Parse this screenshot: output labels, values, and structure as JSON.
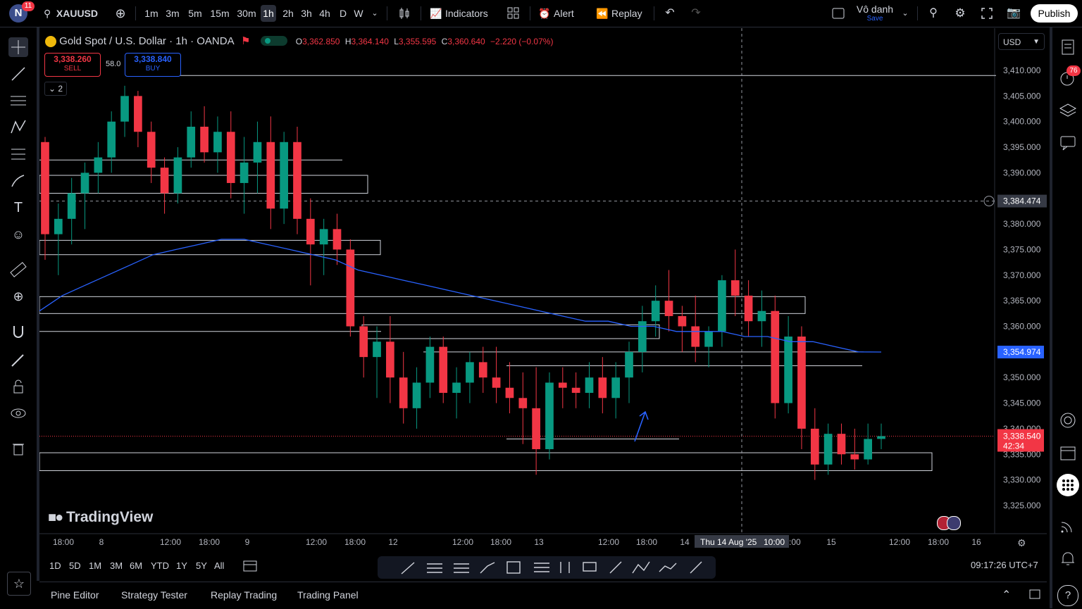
{
  "header": {
    "user_initial": "N",
    "notif_count": "11",
    "symbol": "XAUUSD",
    "timeframes": [
      "1m",
      "3m",
      "5m",
      "15m",
      "30m",
      "1h",
      "2h",
      "3h",
      "4h",
      "D",
      "W"
    ],
    "active_timeframe": "1h",
    "indicators_label": "Indicators",
    "alert_label": "Alert",
    "replay_label": "Replay",
    "layout_name": "Vô danh",
    "layout_save": "Save",
    "publish_label": "Publish"
  },
  "legend": {
    "title": "Gold Spot / U.S. Dollar · 1h · OANDA",
    "o_label": "O",
    "o": "3,362.850",
    "h_label": "H",
    "h": "3,364.140",
    "l_label": "L",
    "l": "3,355.595",
    "c_label": "C",
    "c": "3,360.640",
    "change": "−2.220 (−0.07%)",
    "sell_price": "3,338.260",
    "sell_label": "SELL",
    "spread": "58.0",
    "buy_price": "3,338.840",
    "buy_label": "BUY",
    "collapse_count": "2"
  },
  "price_axis": {
    "currency": "USD",
    "ticks": [
      "3,410.000",
      "3,405.000",
      "3,400.000",
      "3,395.000",
      "3,390.000",
      "3,385.000",
      "3,380.000",
      "3,375.000",
      "3,370.000",
      "3,365.000",
      "3,360.000",
      "3,355.000",
      "3,350.000",
      "3,345.000",
      "3,340.000",
      "3,335.000",
      "3,330.000",
      "3,325.000"
    ],
    "crosshair_price": "3,384.474",
    "ma_price": "3,354.974",
    "last_price": "3,338.540",
    "countdown": "42:34"
  },
  "time_axis": {
    "labels": [
      "18:00",
      "8",
      "12:00",
      "18:00",
      "9",
      "12:00",
      "18:00",
      "12",
      "12:00",
      "18:00",
      "13",
      "12:00",
      "18:00",
      "14",
      "15",
      "12:00",
      "18:00",
      "16"
    ],
    "crosshair_time": "Thu 14 Aug '25",
    "crosshair_time_2": "10:00",
    "partial_label": ":00"
  },
  "watermark": "TradingView",
  "right_panel": {
    "badge": "76"
  },
  "bottom": {
    "ranges": [
      "1D",
      "5D",
      "1M",
      "3M",
      "6M",
      "YTD",
      "1Y",
      "5Y",
      "All"
    ],
    "clock": "09:17:26 UTC+7",
    "tabs": [
      "Pine Editor",
      "Strategy Tester",
      "Replay Trading",
      "Trading Panel"
    ]
  },
  "colors": {
    "up": "#089981",
    "down": "#f23645",
    "ma": "#2962ff",
    "background": "#000000"
  },
  "chart_data": {
    "type": "candlestick",
    "symbol": "XAUUSD",
    "interval": "1h",
    "ylim": [
      3322,
      3412
    ],
    "ohlc": [
      [
        3396,
        3397,
        3373,
        3378
      ],
      [
        3378,
        3384,
        3370,
        3381
      ],
      [
        3381,
        3389,
        3376,
        3386
      ],
      [
        3386,
        3392,
        3379,
        3390
      ],
      [
        3390,
        3396,
        3386,
        3393
      ],
      [
        3393,
        3402,
        3390,
        3400
      ],
      [
        3400,
        3407,
        3397,
        3405
      ],
      [
        3405,
        3406,
        3395,
        3398
      ],
      [
        3398,
        3400,
        3388,
        3391
      ],
      [
        3391,
        3393,
        3382,
        3386
      ],
      [
        3386,
        3395,
        3384,
        3393
      ],
      [
        3393,
        3402,
        3391,
        3399
      ],
      [
        3399,
        3403,
        3392,
        3394
      ],
      [
        3394,
        3401,
        3390,
        3398
      ],
      [
        3398,
        3402,
        3385,
        3388
      ],
      [
        3388,
        3397,
        3382,
        3392
      ],
      [
        3392,
        3400,
        3386,
        3396
      ],
      [
        3396,
        3401,
        3379,
        3383
      ],
      [
        3383,
        3398,
        3380,
        3396
      ],
      [
        3396,
        3399,
        3378,
        3381
      ],
      [
        3381,
        3385,
        3368,
        3376
      ],
      [
        3376,
        3381,
        3370,
        3379
      ],
      [
        3379,
        3382,
        3372,
        3375
      ],
      [
        3375,
        3377,
        3358,
        3360
      ],
      [
        3360,
        3362,
        3350,
        3354
      ],
      [
        3354,
        3360,
        3346,
        3357
      ],
      [
        3357,
        3362,
        3345,
        3350
      ],
      [
        3350,
        3355,
        3341,
        3344
      ],
      [
        3344,
        3352,
        3340,
        3349
      ],
      [
        3349,
        3358,
        3346,
        3356
      ],
      [
        3356,
        3358,
        3345,
        3347
      ],
      [
        3347,
        3352,
        3342,
        3349
      ],
      [
        3349,
        3355,
        3345,
        3353
      ],
      [
        3353,
        3356,
        3347,
        3350
      ],
      [
        3350,
        3356,
        3345,
        3348
      ],
      [
        3348,
        3353,
        3343,
        3346
      ],
      [
        3346,
        3351,
        3337,
        3344
      ],
      [
        3344,
        3352,
        3331,
        3336
      ],
      [
        3336,
        3351,
        3334,
        3349
      ],
      [
        3349,
        3352,
        3344,
        3348
      ],
      [
        3348,
        3351,
        3344,
        3347
      ],
      [
        3347,
        3353,
        3344,
        3350
      ],
      [
        3350,
        3354,
        3343,
        3346
      ],
      [
        3346,
        3353,
        3342,
        3350
      ],
      [
        3350,
        3357,
        3345,
        3355
      ],
      [
        3355,
        3364,
        3351,
        3361
      ],
      [
        3361,
        3368,
        3358,
        3365
      ],
      [
        3365,
        3371,
        3359,
        3362
      ],
      [
        3362,
        3364,
        3355,
        3360
      ],
      [
        3360,
        3366,
        3353,
        3356
      ],
      [
        3356,
        3360,
        3352,
        3359
      ],
      [
        3359,
        3370,
        3356,
        3369
      ],
      [
        3369,
        3375,
        3362,
        3366
      ],
      [
        3366,
        3369,
        3358,
        3361
      ],
      [
        3361,
        3367,
        3356,
        3363
      ],
      [
        3363,
        3366,
        3342,
        3345
      ],
      [
        3345,
        3362,
        3343,
        3358
      ],
      [
        3358,
        3360,
        3336,
        3340
      ],
      [
        3340,
        3344,
        3330,
        3333
      ],
      [
        3333,
        3341,
        3331,
        3339
      ],
      [
        3339,
        3341,
        3333,
        3335
      ],
      [
        3335,
        3340,
        3332,
        3334
      ],
      [
        3334,
        3341,
        3333,
        3338
      ],
      [
        3338,
        3341,
        3336,
        3338.54
      ]
    ],
    "ma_series_name": "",
    "ma": [
      3363,
      3366,
      3368,
      3370,
      3372,
      3374,
      3375,
      3376,
      3377,
      3377,
      3376,
      3375,
      3374,
      3373,
      3371,
      3370,
      3369,
      3368,
      3367,
      3366,
      3365,
      3364,
      3363,
      3362,
      3361,
      3361,
      3360,
      3360,
      3359,
      3359,
      3359,
      3358,
      3358,
      3357,
      3357,
      3356,
      3355,
      3354.974
    ]
  }
}
